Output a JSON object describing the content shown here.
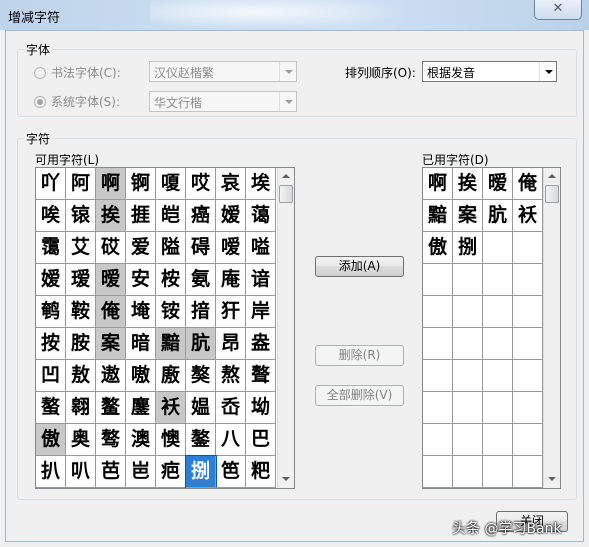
{
  "window": {
    "title": "增减字符",
    "close_label": "✕"
  },
  "font_group": {
    "legend": "字体",
    "calligraphy_label": "书法字体(C):",
    "calligraphy_value": "汉仪赵楷繁",
    "system_label": "系统字体(S):",
    "system_value": "华文行楷",
    "sort_label": "排列顺序(O):",
    "sort_value": "根据发音"
  },
  "chars_group": {
    "legend": "字符",
    "available_label": "可用字符(L)",
    "used_label": "已用字符(D)",
    "available": [
      [
        "吖",
        "阿",
        "啊",
        "锕",
        "嗄",
        "哎",
        "哀",
        "埃"
      ],
      [
        "唉",
        "锿",
        "挨",
        "捱",
        "皑",
        "癌",
        "嫒",
        "蔼"
      ],
      [
        "霭",
        "艾",
        "砹",
        "爱",
        "隘",
        "碍",
        "嗳",
        "嗌"
      ],
      [
        "嫒",
        "瑷",
        "暧",
        "安",
        "桉",
        "氨",
        "庵",
        "谙"
      ],
      [
        "鹌",
        "鞍",
        "俺",
        "埯",
        "铵",
        "揞",
        "犴",
        "岸"
      ],
      [
        "按",
        "胺",
        "案",
        "暗",
        "黯",
        "肮",
        "昂",
        "盎"
      ],
      [
        "凹",
        "敖",
        "遨",
        "嗷",
        "廒",
        "獒",
        "熬",
        "聱"
      ],
      [
        "螯",
        "翱",
        "鳌",
        "鏖",
        "袄",
        "媪",
        "岙",
        "坳"
      ],
      [
        "傲",
        "奥",
        "骜",
        "澳",
        "懊",
        "鏊",
        "八",
        "巴"
      ],
      [
        "扒",
        "叭",
        "芭",
        "岜",
        "疤",
        "捌",
        "笆",
        "粑"
      ]
    ],
    "used_flags": [
      [
        0,
        0,
        1,
        0,
        0,
        0,
        0,
        0
      ],
      [
        0,
        0,
        1,
        0,
        0,
        0,
        0,
        0
      ],
      [
        0,
        0,
        0,
        0,
        0,
        0,
        0,
        0
      ],
      [
        0,
        0,
        1,
        0,
        0,
        0,
        0,
        0
      ],
      [
        0,
        0,
        1,
        0,
        0,
        0,
        0,
        0
      ],
      [
        0,
        0,
        1,
        0,
        1,
        1,
        0,
        0
      ],
      [
        0,
        0,
        0,
        0,
        0,
        0,
        0,
        0
      ],
      [
        0,
        0,
        0,
        0,
        1,
        0,
        0,
        0
      ],
      [
        1,
        0,
        0,
        0,
        0,
        0,
        0,
        0
      ],
      [
        0,
        0,
        0,
        0,
        0,
        2,
        0,
        0
      ]
    ],
    "used": [
      [
        "啊",
        "挨",
        "暧",
        "俺"
      ],
      [
        "黯",
        "案",
        "肮",
        "袄"
      ],
      [
        "傲",
        "捌",
        "",
        ""
      ],
      [
        "",
        "",
        "",
        ""
      ],
      [
        "",
        "",
        "",
        ""
      ],
      [
        "",
        "",
        "",
        ""
      ],
      [
        "",
        "",
        "",
        ""
      ],
      [
        "",
        "",
        "",
        ""
      ],
      [
        "",
        "",
        "",
        ""
      ],
      [
        "",
        "",
        "",
        ""
      ]
    ]
  },
  "buttons": {
    "add": "添加(A)",
    "delete": "删除(R)",
    "delete_all": "全部删除(V)",
    "close": "关闭"
  },
  "watermark": "头条 @学习Bank"
}
